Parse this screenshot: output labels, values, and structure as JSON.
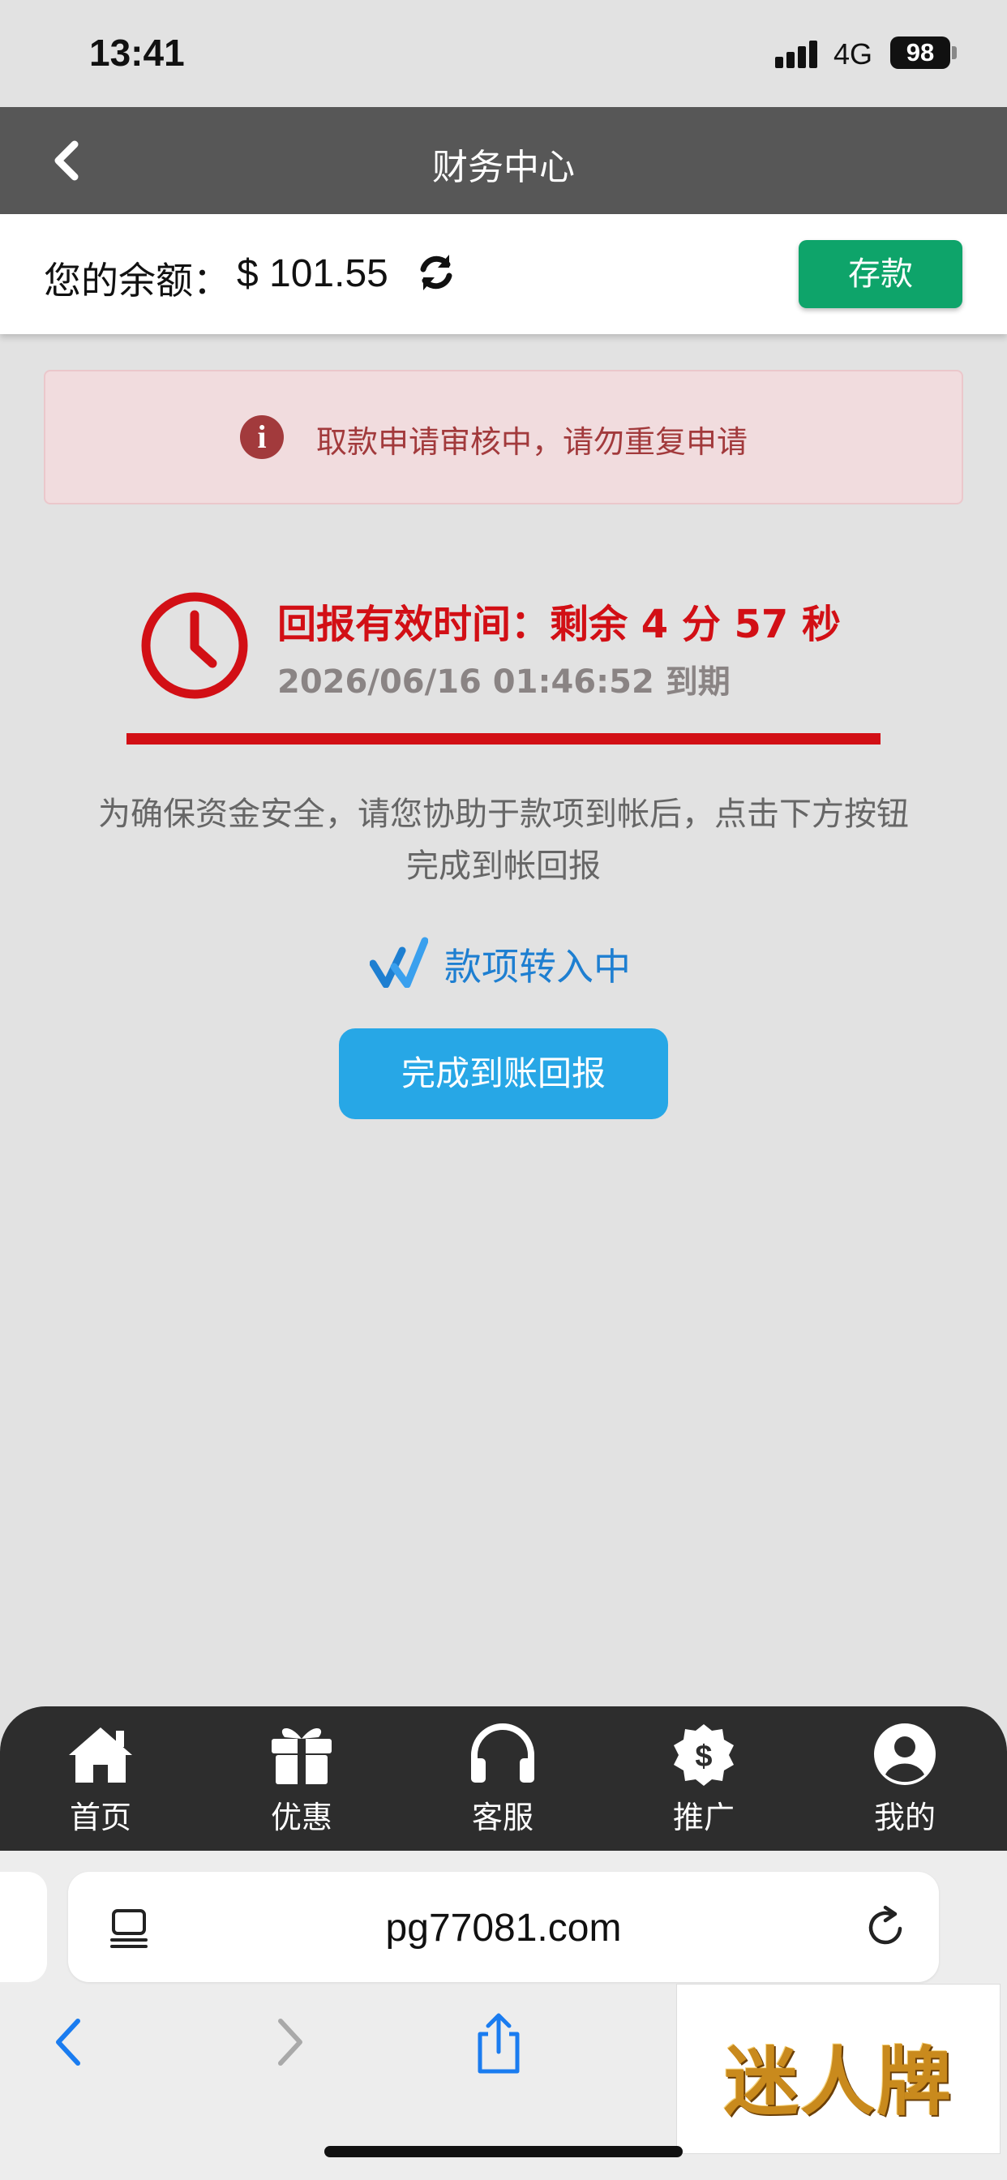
{
  "status_bar": {
    "time": "13:41",
    "network": "4G",
    "battery": "98"
  },
  "nav": {
    "title": "财务中心",
    "back_icon": "chevron-left-icon"
  },
  "balance": {
    "label": "您的余额：",
    "amount": "$ 101.55",
    "refresh_icon": "refresh-icon",
    "deposit_label": "存款"
  },
  "alert": {
    "icon": "info-circle-icon",
    "message": "取款申请审核中，请勿重复申请"
  },
  "timer": {
    "icon": "clock-icon",
    "line1": "回报有效时间：剩余 4 分 57 秒",
    "line2": "2026/06/16 01:46:52 到期"
  },
  "notice": {
    "line1": "为确保资金安全，请您协助于款项到帐后，点击下方按钮",
    "line2": "完成到帐回报"
  },
  "transfer": {
    "icon": "loading-icon",
    "label": "款项转入中"
  },
  "report_button": {
    "label": "完成到账回报"
  },
  "bottom_nav": {
    "items": [
      {
        "label": "首页",
        "icon": "home-icon"
      },
      {
        "label": "优惠",
        "icon": "gift-icon"
      },
      {
        "label": "客服",
        "icon": "headset-icon"
      },
      {
        "label": "推广",
        "icon": "dollar-badge-icon"
      },
      {
        "label": "我的",
        "icon": "user-circle-icon"
      }
    ]
  },
  "browser": {
    "url": "pg77081.com"
  },
  "watermark": {
    "text": "迷人牌"
  },
  "colors": {
    "accent_red": "#d20f15",
    "deposit_green": "#0ea46a",
    "report_blue": "#27a7e6",
    "alert_text": "#a23a3c"
  }
}
